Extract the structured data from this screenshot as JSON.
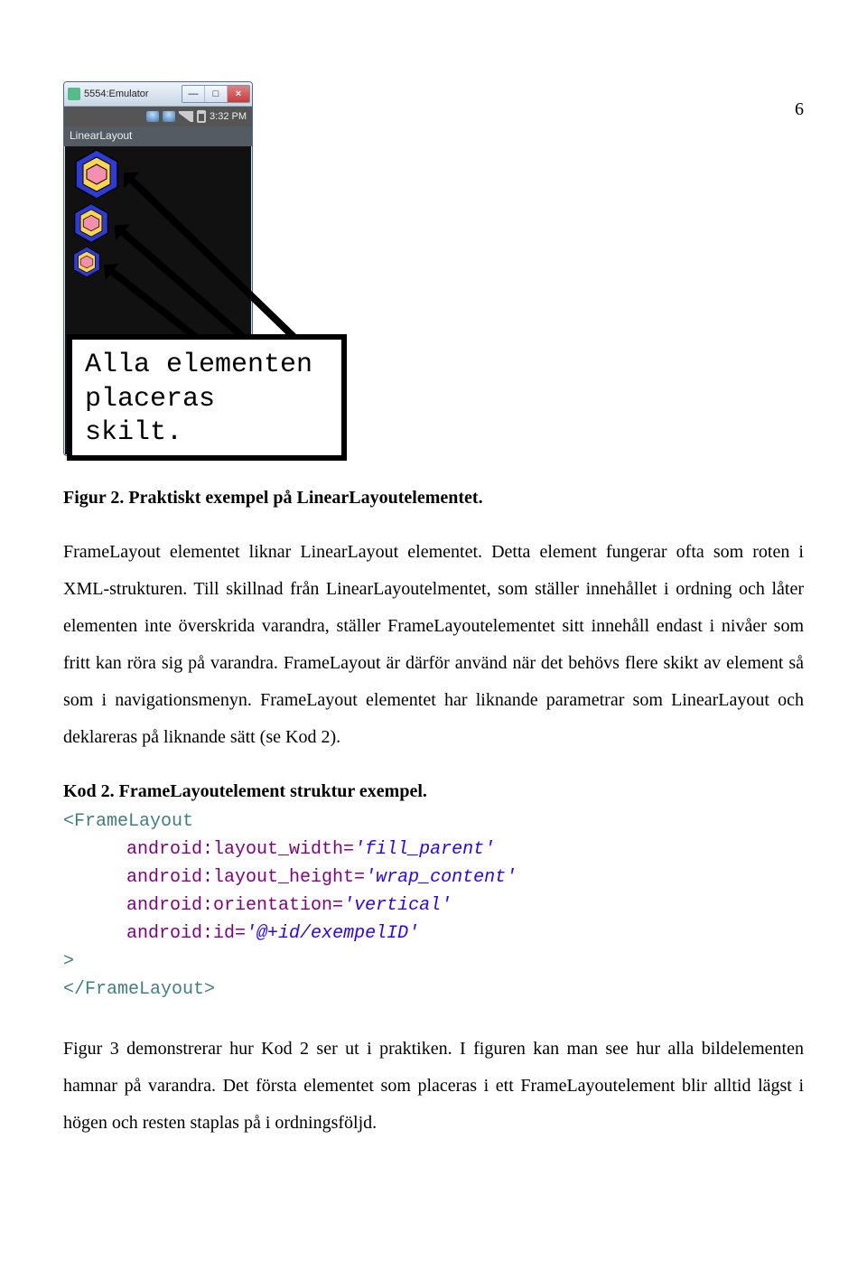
{
  "page_number": "6",
  "emulator": {
    "window_title": "5554:Emulator",
    "status_time": "3:32 PM",
    "app_title": "LinearLayout"
  },
  "callout_text": "Alla elementen placeras skilt.",
  "figure_caption": "Figur 2. Praktiskt exempel på LinearLayoutelementet.",
  "paragraph1": "FrameLayout elementet liknar LinearLayout elementet. Detta element fungerar ofta som roten i XML-strukturen. Till skillnad från LinearLayoutelmentet, som ställer innehållet i ordning och låter elementen inte överskrida varandra, ställer FrameLayoutelementet sitt innehåll endast i nivåer som fritt kan röra sig på varandra. FrameLayout är därför använd när det behövs flere skikt av element så som i navigationsmenyn. FrameLayout elementet har liknande parametrar som LinearLayout och deklareras på liknande sätt (se Kod 2).",
  "code_heading": "Kod 2. FrameLayoutelement struktur exempel.",
  "code": {
    "open_tag": "<FrameLayout",
    "attr1_name": "android:layout_width",
    "attr1_val": "'fill_parent'",
    "attr2_name": "android:layout_height",
    "attr2_val": "'wrap_content'",
    "attr3_name": "android:orientation",
    "attr3_val": "'vertical'",
    "attr4_name": "android:id",
    "attr4_val": "'@+id/exempelID'",
    "close_angle": ">",
    "close_tag": "</FrameLayout>"
  },
  "paragraph2": "Figur 3 demonstrerar hur Kod 2 ser ut i praktiken. I figuren kan man see hur alla bildelementen hamnar på varandra. Det första elementet som placeras i ett FrameLayoutelement blir alltid lägst i högen och resten staplas på i ordningsföljd."
}
